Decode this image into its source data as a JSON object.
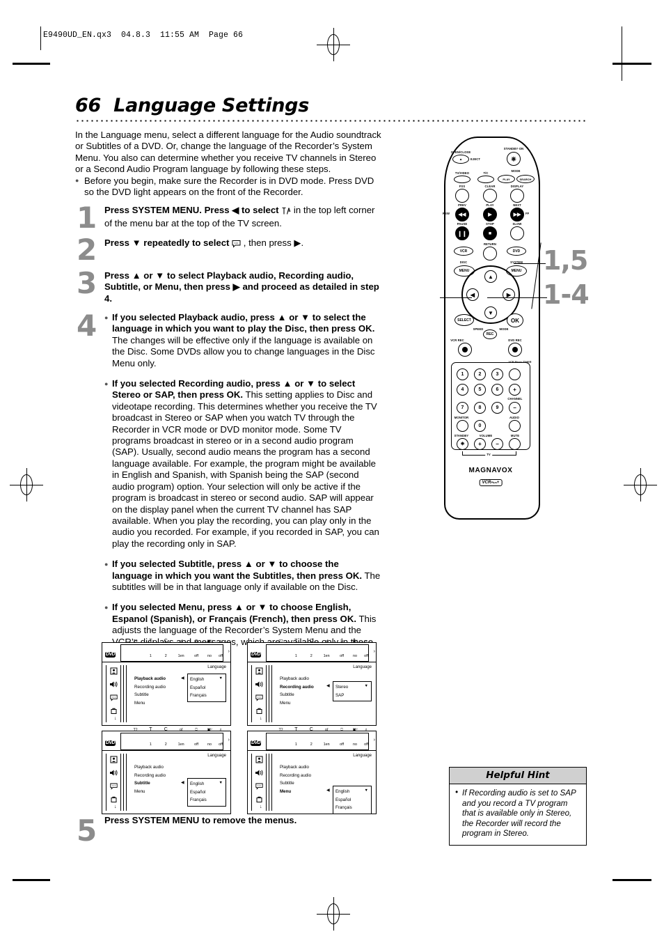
{
  "page": {
    "filestamp": "E9490UD_EN.qx3  04.8.3  11:55 AM  Page 66",
    "number": "66",
    "title": "Language Settings",
    "title_full": "66  Language Settings"
  },
  "intro": {
    "paragraph": "In the Language menu, select a different language for the Audio soundtrack or Subtitles of a DVD. Or, change the language of the Recorder’s System Menu. You also can determine whether you receive TV channels in Stereo or a Second Audio Program language by following these steps.",
    "bullet": "Before you begin, make sure the Recorder is in DVD mode. Press DVD so the DVD light appears on the front of the Recorder."
  },
  "steps": [
    {
      "number": "1",
      "bold_lead": "Press SYSTEM MENU. Press ◀ to select",
      "icon": "subtitle-language-icon",
      "rest": " in the top left corner of the menu bar at the top of the TV screen."
    },
    {
      "number": "2",
      "bold_lead": "Press ▼ repeatedly to select",
      "icon": "speech-balloon-icon",
      "rest": ", then press ▶."
    },
    {
      "number": "3",
      "bold_lead": "Press ▲ or ▼ to select Playback audio, Recording audio, Subtitle, or Menu, then press ▶ and proceed as detailed in step 4.",
      "rest": ""
    },
    {
      "number": "4",
      "blocks": [
        {
          "bold": "If you selected Playback audio, press ▲ or ▼ to select the language in which you want to play the Disc, then press OK.",
          "normal": " The changes will be effective only if the language is available on the Disc. Some DVDs allow you to change languages in the Disc Menu only."
        },
        {
          "bold": "If you selected Recording audio, press ▲ or ▼ to select Stereo or SAP, then press OK.",
          "normal": " This setting applies to Disc and videotape recording. This determines whether you receive the TV broadcast in Stereo or SAP when you watch TV through the Recorder in VCR mode or DVD monitor mode. Some TV programs broadcast in stereo or in a second audio program (SAP). Usually, second audio means the program has a second language available. For example, the program might be available in English and Spanish, with Spanish being the SAP (second audio program) option. Your selection will only be active if the program is broadcast in stereo or second audio. SAP will appear on the display panel when the current TV channel has SAP available. When you play the recording, you can play only in the audio you recorded. For example, if you recorded in SAP, you can play the recording only in SAP."
        },
        {
          "bold": "If you selected Subtitle, press ▲ or ▼ to choose the language in which you want the Subtitles, then press OK.",
          "normal": " The subtitles will be in that language only if available on the Disc."
        },
        {
          "bold": "If you selected Menu, press ▲ or ▼ to choose English, Espanol (Spanish), or Français (French), then press OK.",
          "normal": " This adjusts the language of the Recorder’s System Menu and the VCR’s displays and messages, which are available only in these three languages."
        }
      ]
    },
    {
      "number": "5",
      "bold_lead": "Press SYSTEM MENU",
      "rest": " to remove the menus."
    }
  ],
  "menu_bar": {
    "values": [
      "1",
      "2",
      "1en",
      "off",
      "no",
      "off"
    ],
    "icons": [
      "subtitle-language-icon",
      "title-icon",
      "chapter-icon",
      "audio-language-icon",
      "subtitle-screen-icon",
      "camera-angle-icon",
      "zoom-icon"
    ]
  },
  "screens": [
    {
      "name": "playback-audio-screen",
      "language_label": "Language",
      "items": [
        "Playback audio",
        "Recording audio",
        "Subtitle",
        "Menu"
      ],
      "selected_index": 0,
      "dropdown": [
        "English",
        "Español",
        "Français"
      ],
      "dropdown_selected": "English"
    },
    {
      "name": "recording-audio-screen",
      "language_label": "Language",
      "items": [
        "Playback audio",
        "Recording audio",
        "Subtitle",
        "Menu"
      ],
      "selected_index": 1,
      "dropdown": [
        "Stereo",
        "SAP"
      ],
      "dropdown_selected": "Stereo"
    },
    {
      "name": "subtitle-screen",
      "language_label": "Language",
      "items": [
        "Playback audio",
        "Recording audio",
        "Subtitle",
        "Menu"
      ],
      "selected_index": 2,
      "dropdown": [
        "English",
        "Español",
        "Français"
      ],
      "dropdown_selected": "English"
    },
    {
      "name": "menu-language-screen",
      "language_label": "Language",
      "items": [
        "Playback audio",
        "Recording audio",
        "Subtitle",
        "Menu"
      ],
      "selected_index": 3,
      "dropdown": [
        "English",
        "Español",
        "Français"
      ],
      "dropdown_selected": "English"
    }
  ],
  "remote": {
    "brand": "MAGNAVOX",
    "sub_brand": "VCR Plus+",
    "labels": {
      "open_close": "OPEN/CLOSE",
      "eject": "EJECT",
      "standby_on": "STANDBY·ON",
      "tv_video": "TV/VIDEO",
      "tc": "T/C",
      "mode": "MODE",
      "play": "PLAY",
      "search": "SEARCH",
      "fss": "FSS",
      "clear": "CLEAR",
      "display": "DISPLAY",
      "prev": "PREV",
      "play2": "PLAY",
      "next": "NEXT",
      "rew": "REW",
      "ff": "FF",
      "pause": "PAUSE",
      "stop": "STOP",
      "slow": "SLOW",
      "vcr": "VCR",
      "return": "RETURN",
      "dvd": "DVD",
      "disc": "DISC",
      "system": "SYSTEM",
      "menu_left": "MENU",
      "menu_right": "MENU",
      "select": "SELECT",
      "ok": "OK",
      "speed": "SPEED",
      "rec": "REC",
      "mode2": "MODE",
      "vcr_rec": "VCR REC",
      "dvd_rec": "DVD REC",
      "vcrplus_timer": "VCR Plus+ /TIMER",
      "channel": "CHANNEL",
      "monitor": "MONITOR",
      "audio": "AUDIO",
      "standby": "STANDBY",
      "volume": "VOLUME",
      "mute": "MUTE",
      "tv": "TV"
    },
    "keypad": [
      "1",
      "2",
      "3",
      "4",
      "5",
      "6",
      "7",
      "8",
      "9",
      "0"
    ]
  },
  "callouts": [
    {
      "name": "callout-steps-1-5",
      "text": "1,5"
    },
    {
      "name": "callout-steps-1-4",
      "text": "1-4"
    }
  ],
  "hint": {
    "heading": "Helpful Hint",
    "text": "If Recording audio is set to SAP and you record a TV program that is available only in Stereo, the Recorder will record the program in Stereo."
  }
}
